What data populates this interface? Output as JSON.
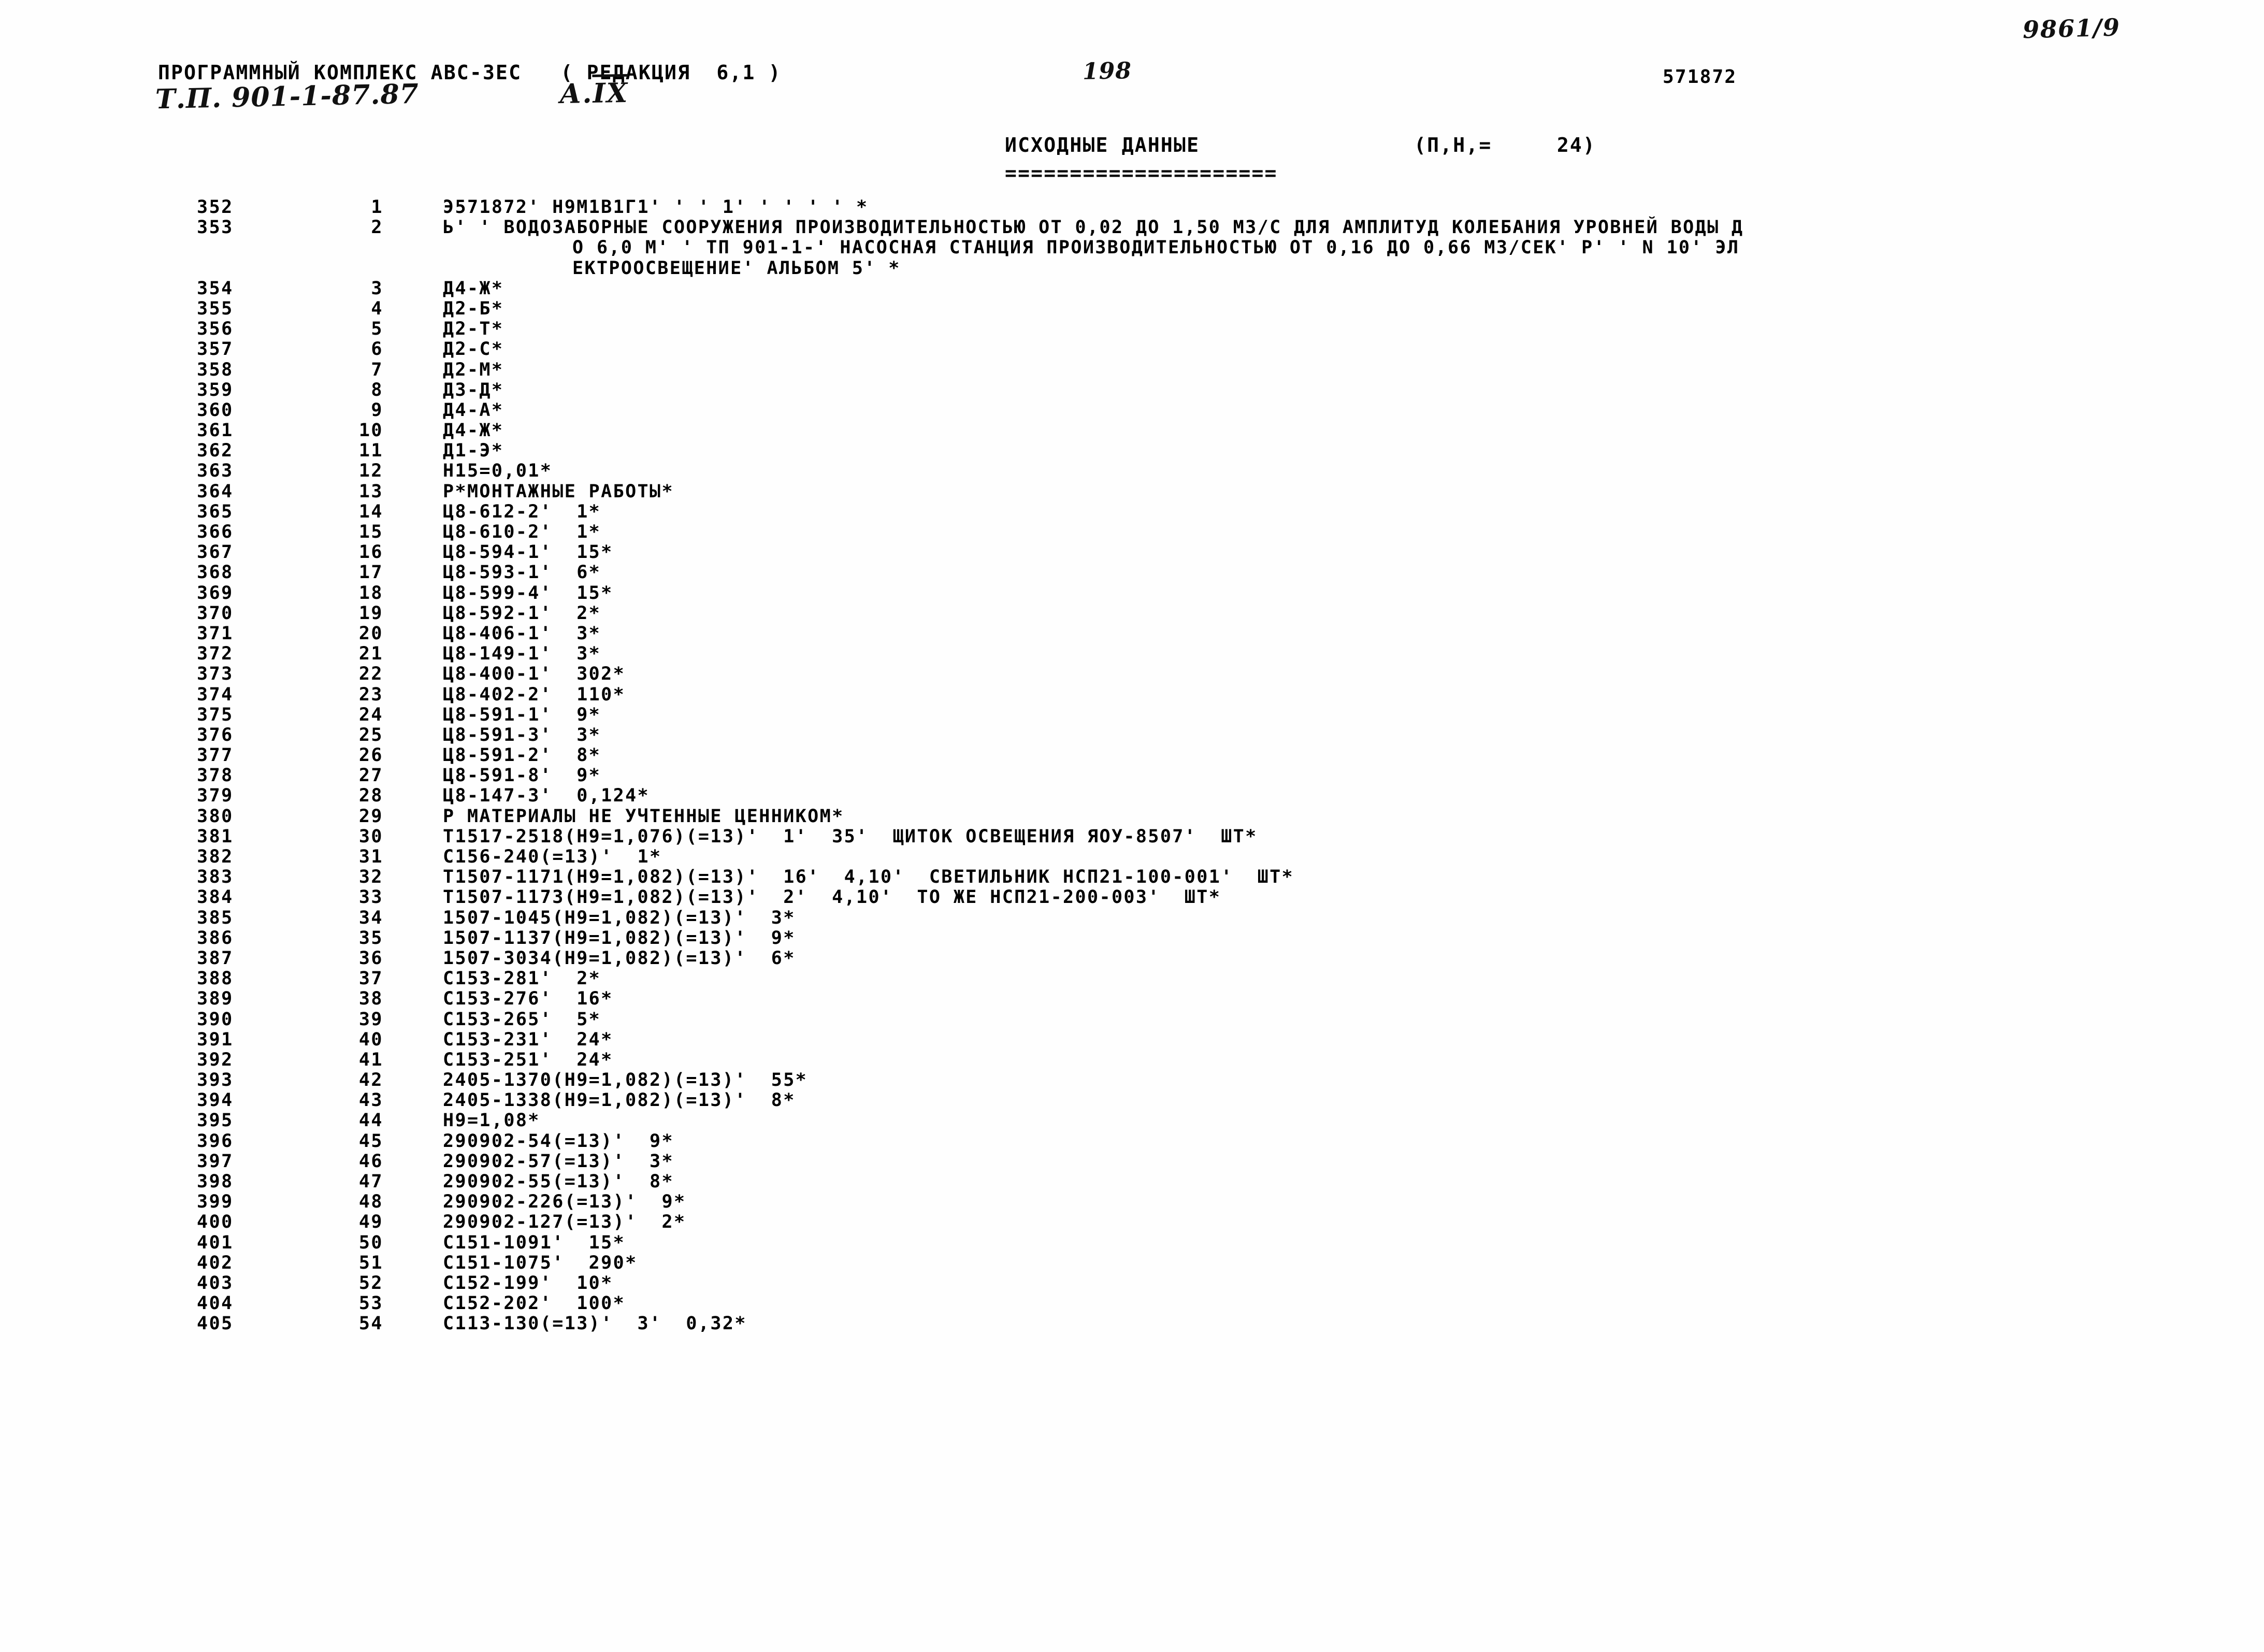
{
  "annotations": {
    "archive_ref": "9861/9",
    "page_number": "198",
    "project_number": "Т.П. 901-1-87.87",
    "album_prefix": "А.",
    "album_roman": "IX"
  },
  "header": {
    "complex_line": "ПРОГРАММНЫЙ КОМПЛЕКС АВС-ЗЕС   ( РЕДАКЦИЯ  6,1 )",
    "object_code": "571872"
  },
  "title": {
    "heading": "ИСХОДНЫЕ ДАННЫЕ",
    "pn_label": "(П,Н,=",
    "pn_value": "24)",
    "rule": "====================="
  },
  "listing": {
    "rows": [
      {
        "seq": "352",
        "num": "1",
        "text": "Э571872' Н9М1В1Г1' ' ' 1' ' ' ' ' *"
      },
      {
        "seq": "353",
        "num": "2",
        "text": "Ь' ' ВОДОЗАБОРНЫЕ СООРУЖЕНИЯ ПРОИЗВОДИТЕЛЬНОСТЬЮ ОТ 0,02 ДО 1,50 М3/С ДЛЯ АМПЛИТУД КОЛЕБАНИЯ УРОВНЕЙ ВОДЫ Д"
      },
      {
        "seq": "",
        "num": "",
        "cont": true,
        "text": "О 6,0 М' ' ТП 901-1-' НАСОСНАЯ СТАНЦИЯ ПРОИЗВОДИТЕЛЬНОСТЬЮ ОТ 0,16 ДО 0,66 М3/СЕК' Р' ' N 10' ЭЛ"
      },
      {
        "seq": "",
        "num": "",
        "cont": true,
        "text": "ЕКТРООСВЕЩЕНИЕ' АЛЬБОМ 5' *"
      },
      {
        "seq": "354",
        "num": "3",
        "text": "Д4-Ж*"
      },
      {
        "seq": "355",
        "num": "4",
        "text": "Д2-Б*"
      },
      {
        "seq": "356",
        "num": "5",
        "text": "Д2-Т*"
      },
      {
        "seq": "357",
        "num": "6",
        "text": "Д2-С*"
      },
      {
        "seq": "358",
        "num": "7",
        "text": "Д2-М*"
      },
      {
        "seq": "359",
        "num": "8",
        "text": "Д3-Д*"
      },
      {
        "seq": "360",
        "num": "9",
        "text": "Д4-А*"
      },
      {
        "seq": "361",
        "num": "10",
        "text": "Д4-Ж*"
      },
      {
        "seq": "362",
        "num": "11",
        "text": "Д1-Э*"
      },
      {
        "seq": "363",
        "num": "12",
        "text": "Н15=0,01*"
      },
      {
        "seq": "364",
        "num": "13",
        "text": "Р*МОНТАЖНЫЕ РАБОТЫ*"
      },
      {
        "seq": "365",
        "num": "14",
        "text": "Ц8-612-2'  1*"
      },
      {
        "seq": "366",
        "num": "15",
        "text": "Ц8-610-2'  1*"
      },
      {
        "seq": "367",
        "num": "16",
        "text": "Ц8-594-1'  15*"
      },
      {
        "seq": "368",
        "num": "17",
        "text": "Ц8-593-1'  6*"
      },
      {
        "seq": "369",
        "num": "18",
        "text": "Ц8-599-4'  15*"
      },
      {
        "seq": "370",
        "num": "19",
        "text": "Ц8-592-1'  2*"
      },
      {
        "seq": "371",
        "num": "20",
        "text": "Ц8-406-1'  3*"
      },
      {
        "seq": "372",
        "num": "21",
        "text": "Ц8-149-1'  3*"
      },
      {
        "seq": "373",
        "num": "22",
        "text": "Ц8-400-1'  302*"
      },
      {
        "seq": "374",
        "num": "23",
        "text": "Ц8-402-2'  110*"
      },
      {
        "seq": "375",
        "num": "24",
        "text": "Ц8-591-1'  9*"
      },
      {
        "seq": "376",
        "num": "25",
        "text": "Ц8-591-3'  3*"
      },
      {
        "seq": "377",
        "num": "26",
        "text": "Ц8-591-2'  8*"
      },
      {
        "seq": "378",
        "num": "27",
        "text": "Ц8-591-8'  9*"
      },
      {
        "seq": "379",
        "num": "28",
        "text": "Ц8-147-3'  0,124*"
      },
      {
        "seq": "380",
        "num": "29",
        "text": "Р МАТЕРИАЛЫ НЕ УЧТЕННЫЕ ЦЕННИКОМ*"
      },
      {
        "seq": "381",
        "num": "30",
        "text": "Т1517-2518(Н9=1,076)(=13)'  1'  35'  ЩИТОК ОСВЕЩЕНИЯ ЯОУ-8507'  ШТ*"
      },
      {
        "seq": "382",
        "num": "31",
        "text": "С156-240(=13)'  1*"
      },
      {
        "seq": "383",
        "num": "32",
        "text": "Т1507-1171(Н9=1,082)(=13)'  16'  4,10'  СВЕТИЛЬНИК НСП21-100-001'  ШТ*"
      },
      {
        "seq": "384",
        "num": "33",
        "text": "Т1507-1173(Н9=1,082)(=13)'  2'  4,10'  ТО ЖЕ НСП21-200-003'  ШТ*"
      },
      {
        "seq": "385",
        "num": "34",
        "text": "1507-1045(Н9=1,082)(=13)'  3*"
      },
      {
        "seq": "386",
        "num": "35",
        "text": "1507-1137(Н9=1,082)(=13)'  9*"
      },
      {
        "seq": "387",
        "num": "36",
        "text": "1507-3034(Н9=1,082)(=13)'  6*"
      },
      {
        "seq": "388",
        "num": "37",
        "text": "С153-281'  2*"
      },
      {
        "seq": "389",
        "num": "38",
        "text": "С153-276'  16*"
      },
      {
        "seq": "390",
        "num": "39",
        "text": "С153-265'  5*"
      },
      {
        "seq": "391",
        "num": "40",
        "text": "С153-231'  24*"
      },
      {
        "seq": "392",
        "num": "41",
        "text": "С153-251'  24*"
      },
      {
        "seq": "393",
        "num": "42",
        "text": "2405-1370(Н9=1,082)(=13)'  55*"
      },
      {
        "seq": "394",
        "num": "43",
        "text": "2405-1338(Н9=1,082)(=13)'  8*"
      },
      {
        "seq": "395",
        "num": "44",
        "text": "Н9=1,08*"
      },
      {
        "seq": "396",
        "num": "45",
        "text": "290902-54(=13)'  9*"
      },
      {
        "seq": "397",
        "num": "46",
        "text": "290902-57(=13)'  3*"
      },
      {
        "seq": "398",
        "num": "47",
        "text": "290902-55(=13)'  8*"
      },
      {
        "seq": "399",
        "num": "48",
        "text": "290902-226(=13)'  9*"
      },
      {
        "seq": "400",
        "num": "49",
        "text": "290902-127(=13)'  2*"
      },
      {
        "seq": "401",
        "num": "50",
        "text": "С151-1091'  15*"
      },
      {
        "seq": "402",
        "num": "51",
        "text": "С151-1075'  290*"
      },
      {
        "seq": "403",
        "num": "52",
        "text": "С152-199'  10*"
      },
      {
        "seq": "404",
        "num": "53",
        "text": "С152-202'  100*"
      },
      {
        "seq": "405",
        "num": "54",
        "text": "С113-130(=13)'  3'  0,32*"
      }
    ]
  }
}
